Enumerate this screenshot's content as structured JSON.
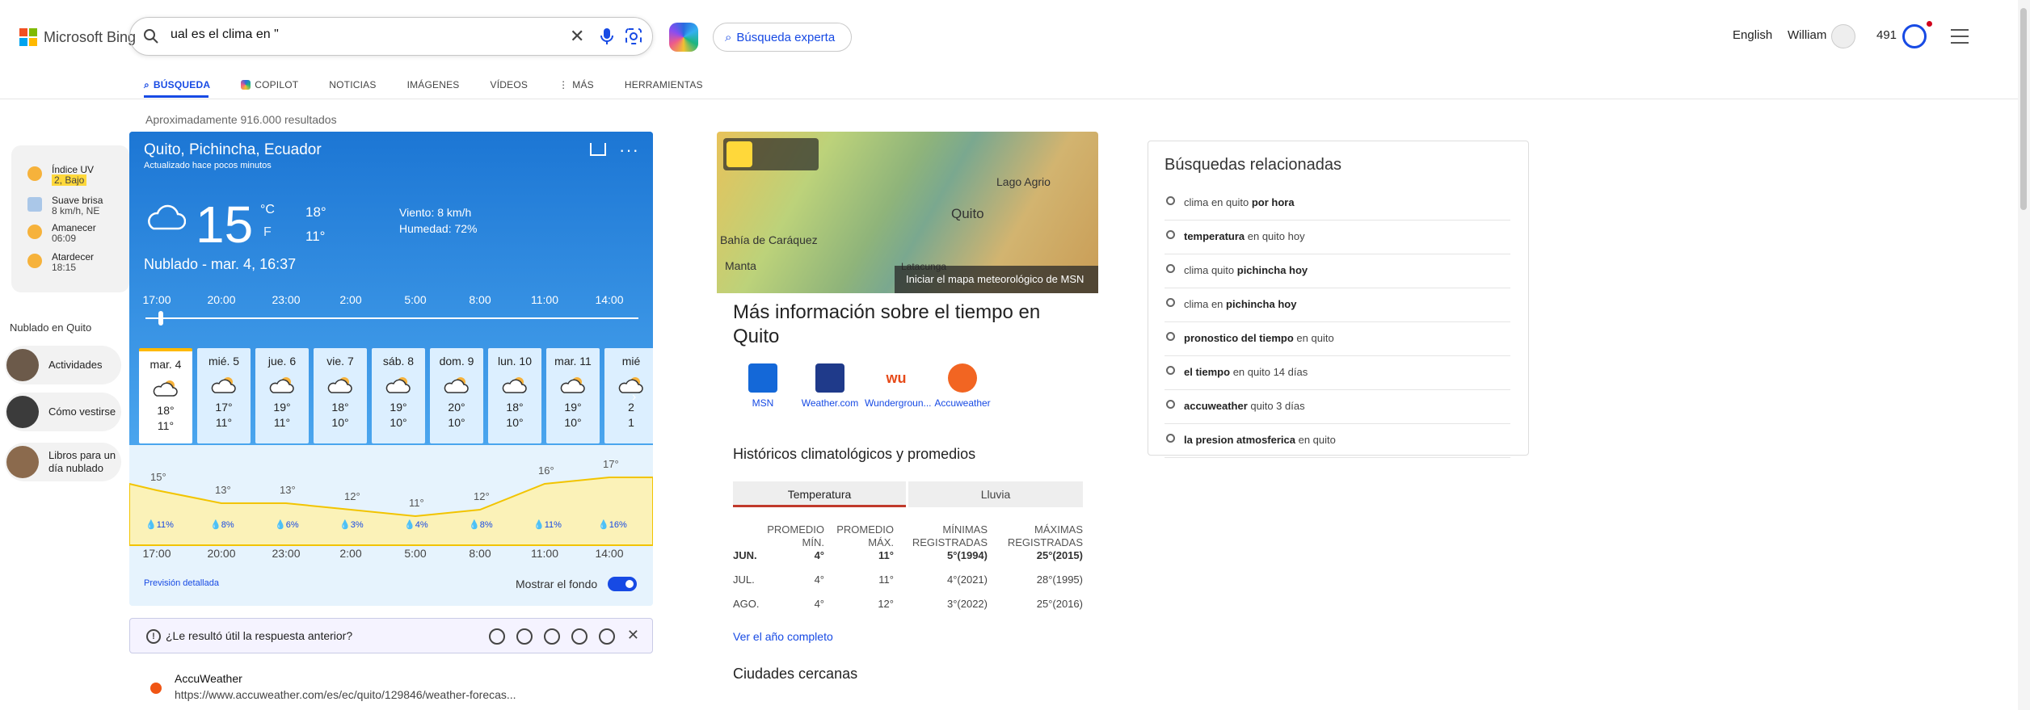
{
  "header": {
    "brand": "Microsoft Bing",
    "query": "ual es el clima en \"",
    "expert": "Búsqueda experta",
    "lang": "English",
    "user": "William",
    "points": "491"
  },
  "tabs": [
    "BÚSQUEDA",
    "COPILOT",
    "NOTICIAS",
    "IMÁGENES",
    "VÍDEOS",
    "MÁS",
    "HERRAMIENTAS"
  ],
  "result_count": "Aproximadamente 916.000 resultados",
  "rail": {
    "uv_title": "Índice UV",
    "uv_value": "2, Bajo",
    "wind_title": "Suave brisa",
    "wind_value": "8 km/h, NE",
    "sunrise_title": "Amanecer",
    "sunrise_value": "06:09",
    "sunset_title": "Atardecer",
    "sunset_value": "18:15",
    "section": "Nublado en Quito",
    "act1": "Actividades",
    "act2": "Cómo vestirse",
    "act3": "Libros para un día nublado"
  },
  "weather": {
    "location": "Quito, Pichincha, Ecuador",
    "updated": "Actualizado hace pocos minutos",
    "temp": "15",
    "unit_c": "°C",
    "unit_f": "F",
    "hi": "18°",
    "lo": "11°",
    "wind": "Viento: 8 km/h",
    "humidity": "Humedad: 72%",
    "condition": "Nublado - mar. 4, 16:37",
    "hours": [
      "17:00",
      "20:00",
      "23:00",
      "2:00",
      "5:00",
      "8:00",
      "11:00",
      "14:00"
    ],
    "days": [
      {
        "d": "mar. 4",
        "h": "18°",
        "l": "11°"
      },
      {
        "d": "mié. 5",
        "h": "17°",
        "l": "11°"
      },
      {
        "d": "jue. 6",
        "h": "19°",
        "l": "11°"
      },
      {
        "d": "vie. 7",
        "h": "18°",
        "l": "10°"
      },
      {
        "d": "sáb. 8",
        "h": "19°",
        "l": "10°"
      },
      {
        "d": "dom. 9",
        "h": "20°",
        "l": "10°"
      },
      {
        "d": "lun. 10",
        "h": "18°",
        "l": "10°"
      },
      {
        "d": "mar. 11",
        "h": "19°",
        "l": "10°"
      },
      {
        "d": "mié",
        "h": "2",
        "l": "1"
      }
    ],
    "graph_temps": [
      "15°",
      "13°",
      "13°",
      "12°",
      "11°",
      "12°",
      "16°",
      "17°"
    ],
    "graph_precip": [
      "11%",
      "8%",
      "6%",
      "3%",
      "4%",
      "8%",
      "11%",
      "16%"
    ],
    "detail": "Previsión detallada",
    "bg_label": "Mostrar el fondo"
  },
  "feedback": "¿Le resultó útil la respuesta anterior?",
  "accu": {
    "name": "AccuWeather",
    "url": "https://www.accuweather.com/es/ec/quito/129846/weather-forecas..."
  },
  "map": {
    "cta": "Iniciar el mapa meteorológico de MSN",
    "city": "Quito",
    "l1": "Lago Agrio",
    "l2": "Bahía de Caráquez",
    "l3": "Manta",
    "l4": "Latacunga"
  },
  "more": {
    "title": "Más información sobre el tiempo en Quito",
    "sources": [
      "MSN",
      "Weather.com",
      "Wundergroun...",
      "Accuweather"
    ]
  },
  "hist": {
    "title": "Históricos climatológicos y promedios",
    "tab1": "Temperatura",
    "tab2": "Lluvia",
    "h1": "PROMEDIO MÍN.",
    "h2": "PROMEDIO MÁX.",
    "h3": "MÍNIMAS REGISTRADAS",
    "h4": "MÁXIMAS REGISTRADAS",
    "rows": [
      {
        "m": "JUN.",
        "a": "4°",
        "b": "11°",
        "c": "5°(1994)",
        "d": "25°(2015)"
      },
      {
        "m": "JUL.",
        "a": "4°",
        "b": "11°",
        "c": "4°(2021)",
        "d": "28°(1995)"
      },
      {
        "m": "AGO.",
        "a": "4°",
        "b": "12°",
        "c": "3°(2022)",
        "d": "25°(2016)"
      }
    ],
    "link": "Ver el año completo",
    "nearby": "Ciudades cercanas"
  },
  "related": {
    "title": "Búsquedas relacionadas",
    "items": [
      {
        "a": "clima en quito ",
        "b": "por hora",
        "c": ""
      },
      {
        "a": "",
        "b": "temperatura",
        "c": " en quito hoy"
      },
      {
        "a": "clima quito ",
        "b": "pichincha hoy",
        "c": ""
      },
      {
        "a": "clima en ",
        "b": "pichincha hoy",
        "c": ""
      },
      {
        "a": "",
        "b": "pronostico del tiempo",
        "c": " en quito"
      },
      {
        "a": "",
        "b": "el tiempo",
        "c": " en quito 14 días"
      },
      {
        "a": "",
        "b": "accuweather",
        "c": " quito 3 días"
      },
      {
        "a": "",
        "b": "la presion atmosferica",
        "c": " en quito"
      }
    ]
  }
}
